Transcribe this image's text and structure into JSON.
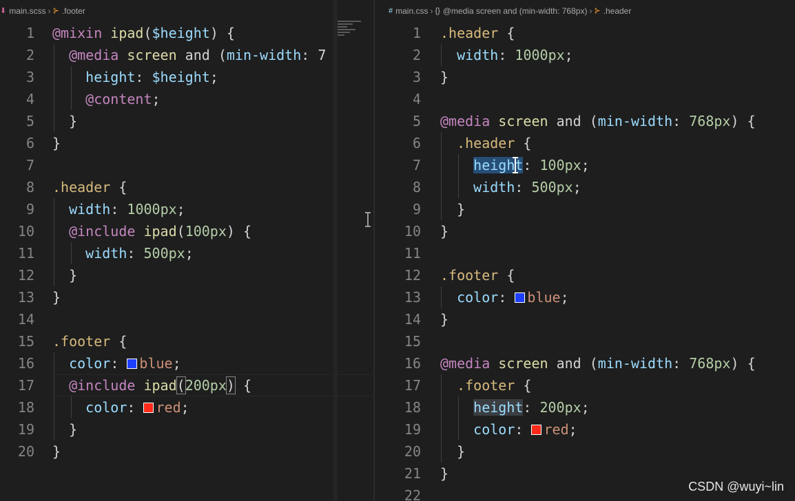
{
  "left": {
    "breadcrumb": {
      "file": "main.scss",
      "symbol": ".footer"
    },
    "lines": [
      {
        "n": "1"
      },
      {
        "n": "2"
      },
      {
        "n": "3"
      },
      {
        "n": "4"
      },
      {
        "n": "5"
      },
      {
        "n": "6"
      },
      {
        "n": "7"
      },
      {
        "n": "8"
      },
      {
        "n": "9"
      },
      {
        "n": "10"
      },
      {
        "n": "11"
      },
      {
        "n": "12"
      },
      {
        "n": "13"
      },
      {
        "n": "14"
      },
      {
        "n": "15"
      },
      {
        "n": "16"
      },
      {
        "n": "17"
      },
      {
        "n": "18"
      },
      {
        "n": "19"
      },
      {
        "n": "20"
      }
    ],
    "tokens": {
      "l1": [
        "@mixin",
        " ",
        "ipad",
        "(",
        "$height",
        ") {"
      ],
      "l2": [
        "@media",
        " ",
        "screen",
        " and (",
        "min-width",
        ": 7"
      ],
      "l3": [
        "height",
        ": ",
        "$height",
        ";"
      ],
      "l4": [
        "@content",
        ";"
      ],
      "l5": [
        "}"
      ],
      "l6": [
        "}"
      ],
      "l8": [
        ".header",
        " {"
      ],
      "l9": [
        "width",
        ": ",
        "1000px",
        ";"
      ],
      "l10": [
        "@include",
        " ",
        "ipad",
        "(",
        "100px",
        ") {"
      ],
      "l11": [
        "width",
        ": ",
        "500px",
        ";"
      ],
      "l12": [
        "}"
      ],
      "l13": [
        "}"
      ],
      "l15": [
        ".footer",
        " {"
      ],
      "l16": [
        "color",
        ": ",
        "blue",
        ";"
      ],
      "l17": [
        "@include",
        " ",
        "ipad",
        "(",
        "200px",
        ")",
        " {"
      ],
      "l18": [
        "color",
        ": ",
        "red",
        ";"
      ],
      "l19": [
        "}"
      ],
      "l20": [
        "}"
      ]
    }
  },
  "right": {
    "breadcrumb": {
      "file": "main.css",
      "braces": "{}",
      "media": "@media screen and (min-width: 768px)",
      "symbol": ".header"
    },
    "lines": [
      {
        "n": "1"
      },
      {
        "n": "2"
      },
      {
        "n": "3"
      },
      {
        "n": "4"
      },
      {
        "n": "5"
      },
      {
        "n": "6"
      },
      {
        "n": "7"
      },
      {
        "n": "8"
      },
      {
        "n": "9"
      },
      {
        "n": "10"
      },
      {
        "n": "11"
      },
      {
        "n": "12"
      },
      {
        "n": "13"
      },
      {
        "n": "14"
      },
      {
        "n": "15"
      },
      {
        "n": "16"
      },
      {
        "n": "17"
      },
      {
        "n": "18"
      },
      {
        "n": "19"
      },
      {
        "n": "20"
      },
      {
        "n": "21"
      },
      {
        "n": "22"
      }
    ],
    "tokens": {
      "r1": [
        ".header",
        " {"
      ],
      "r2": [
        "width",
        ": ",
        "1000px",
        ";"
      ],
      "r3": [
        "}"
      ],
      "r5": [
        "@media",
        " ",
        "screen",
        " and (",
        "min-width",
        ": ",
        "768px",
        ") {"
      ],
      "r6": [
        ".header",
        " {"
      ],
      "r7": [
        "height",
        ": ",
        "100px",
        ";"
      ],
      "r8": [
        "width",
        ": ",
        "500px",
        ";"
      ],
      "r9": [
        "}"
      ],
      "r10": [
        "}"
      ],
      "r12": [
        ".footer",
        " {"
      ],
      "r13": [
        "color",
        ": ",
        "blue",
        ";"
      ],
      "r14": [
        "}"
      ],
      "r16": [
        "@media",
        " ",
        "screen",
        " and (",
        "min-width",
        ": ",
        "768px",
        ") {"
      ],
      "r17": [
        ".footer",
        " {"
      ],
      "r18": [
        "height",
        ": ",
        "200px",
        ";"
      ],
      "r19": [
        "color",
        ": ",
        "red",
        ";"
      ],
      "r20": [
        "}"
      ],
      "r21": [
        "}"
      ]
    }
  },
  "colors": {
    "blue_swatch": "#1f3fff",
    "red_swatch": "#ff2a1a",
    "selection": "#264f78"
  },
  "watermark": "CSDN @wuyi~lin"
}
